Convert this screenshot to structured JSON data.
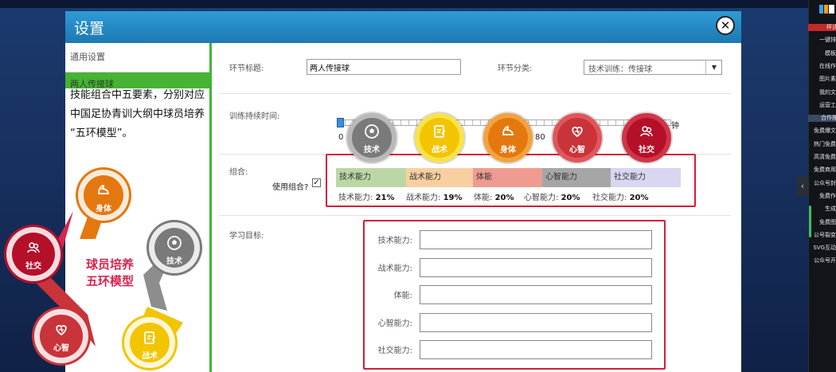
{
  "dialog": {
    "title": "设置",
    "close_symbol": "✕"
  },
  "nav": {
    "general": "通用设置",
    "active_item": "两人传接球"
  },
  "overlay": {
    "line1": "技能组合中五要素，分别对应",
    "line2": "中国足协青训大纲中球员培养",
    "line3": "“五环模型”。"
  },
  "form": {
    "title_label": "环节标题:",
    "title_value": "两人传接球",
    "category_label": "环节分类:",
    "category_value": "技术训练：传接球",
    "duration_label": "训练持续时间:",
    "slider_min": "0",
    "slider_mid": "80",
    "slider_unit": "钟",
    "combo_label": "组合:",
    "use_combo_label": "使用组合?",
    "use_combo_checked": "✓",
    "goals_label": "学习目标:"
  },
  "combo": {
    "segments": [
      {
        "label": "技术能力",
        "color": "#bcd7a6",
        "share": 21
      },
      {
        "label": "战术能力",
        "color": "#f7cfa1",
        "share": 19
      },
      {
        "label": "体能",
        "color": "#ef9b92",
        "share": 20
      },
      {
        "label": "心智能力",
        "color": "#a6a6a6",
        "share": 20
      },
      {
        "label": "社交能力",
        "color": "#d8d6f0",
        "share": 20
      }
    ],
    "pcts": [
      {
        "label": "技术能力:",
        "value": "21%"
      },
      {
        "label": "战术能力:",
        "value": "19%"
      },
      {
        "label": "体能:",
        "value": "20%"
      },
      {
        "label": "心智能力:",
        "value": "20%"
      },
      {
        "label": "社交能力:",
        "value": "20%"
      }
    ]
  },
  "goals": [
    {
      "label": "技术能力:"
    },
    {
      "label": "战术能力:"
    },
    {
      "label": "体能:"
    },
    {
      "label": "心智能力:"
    },
    {
      "label": "社交能力:"
    }
  ],
  "element_circles": [
    {
      "label": "技术",
      "icon": "ball-icon",
      "color": "#7a7a7a",
      "ring": "#b9b9b9"
    },
    {
      "label": "战术",
      "icon": "tactics-icon",
      "color": "#f2c500",
      "ring": "#f7e34a"
    },
    {
      "label": "身体",
      "icon": "muscle-icon",
      "color": "#e4780f",
      "ring": "#f3a23c"
    },
    {
      "label": "心智",
      "icon": "heart-icon",
      "color": "#c9333a",
      "ring": "#e0565b"
    },
    {
      "label": "社交",
      "icon": "people-icon",
      "color": "#b4102a",
      "ring": "#d23447"
    }
  ],
  "model": {
    "title_line1": "球员培养",
    "title_line2": "五环模型",
    "nodes": [
      {
        "label": "身体",
        "icon": "muscle-icon",
        "color": "#e4780f"
      },
      {
        "label": "技术",
        "icon": "ball-icon",
        "color": "#7a7a7a"
      },
      {
        "label": "社交",
        "icon": "people-icon",
        "color": "#b4102a"
      },
      {
        "label": "心智",
        "icon": "heart-icon",
        "color": "#c9333a"
      },
      {
        "label": "战术",
        "icon": "tactics-icon",
        "color": "#f2c500"
      }
    ]
  },
  "sidebar": {
    "items": [
      "样式",
      "一键排",
      "模板",
      "在线作",
      "图片素",
      "我的文",
      "运营工",
      "合作推",
      "免费爆文",
      "热门免费",
      "高清免费",
      "免费商用",
      "公众号封",
      "免费作",
      "生成",
      "免费图",
      "公号裂变",
      "SVG互动",
      "公众号开"
    ]
  }
}
